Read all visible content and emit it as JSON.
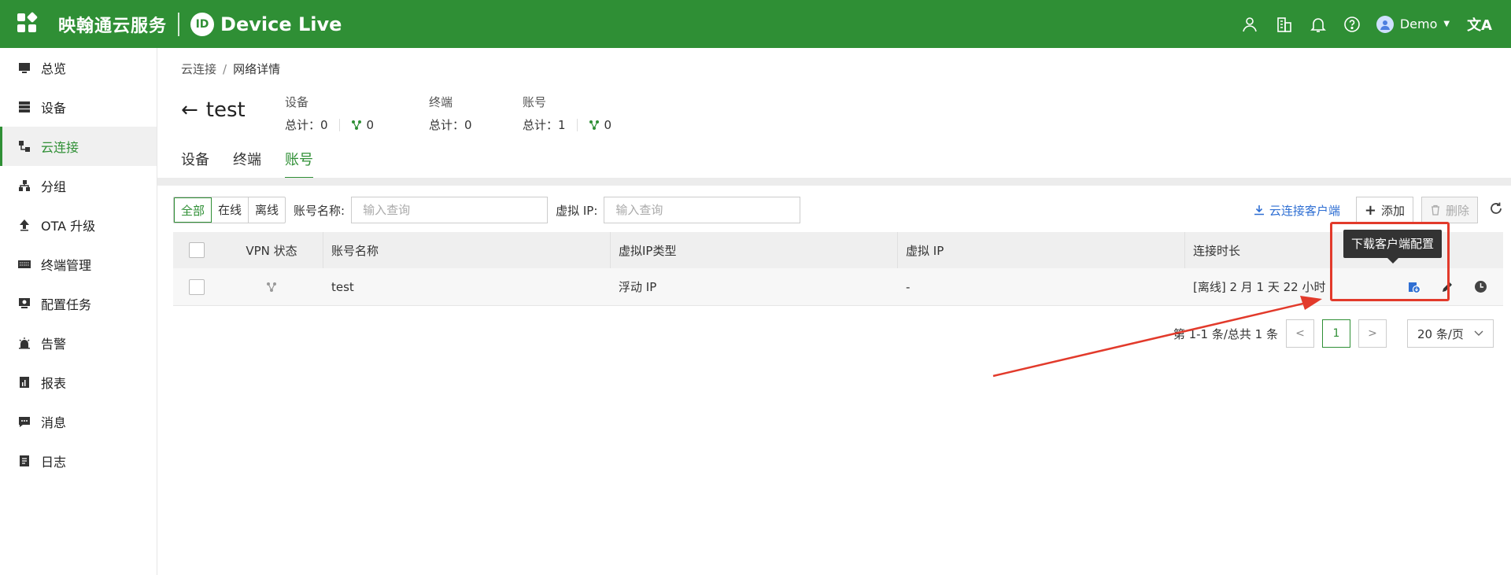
{
  "header": {
    "brand_cn": "映翰通云服务",
    "logo_text": "ID",
    "brand_en": "Device Live",
    "user": "Demo",
    "lang_icon": "文A"
  },
  "sidebar": {
    "items": [
      {
        "label": "总览",
        "icon": "monitor-icon"
      },
      {
        "label": "设备",
        "icon": "server-icon"
      },
      {
        "label": "云连接",
        "icon": "network-icon",
        "active": true
      },
      {
        "label": "分组",
        "icon": "hierarchy-icon"
      },
      {
        "label": "OTA 升级",
        "icon": "upload-icon"
      },
      {
        "label": "终端管理",
        "icon": "keyboard-icon"
      },
      {
        "label": "配置任务",
        "icon": "config-icon"
      },
      {
        "label": "告警",
        "icon": "alarm-icon"
      },
      {
        "label": "报表",
        "icon": "report-icon"
      },
      {
        "label": "消息",
        "icon": "message-icon"
      },
      {
        "label": "日志",
        "icon": "log-icon"
      }
    ]
  },
  "breadcrumb": {
    "parent": "云连接",
    "separator": "/",
    "current": "网络详情"
  },
  "page": {
    "title": "test"
  },
  "stats": {
    "device": {
      "label": "设备",
      "total": "总计：0",
      "online": "0"
    },
    "terminal": {
      "label": "终端",
      "total": "总计：0"
    },
    "account": {
      "label": "账号",
      "total": "总计：1",
      "online": "0"
    }
  },
  "tabs": [
    "设备",
    "终端",
    "账号"
  ],
  "toolbar": {
    "filters": [
      "全部",
      "在线",
      "离线"
    ],
    "account_label": "账号名称:",
    "account_placeholder": "输入查询",
    "vip_label": "虚拟 IP:",
    "vip_placeholder": "输入查询",
    "download_client": "云连接客户端",
    "add": "添加",
    "delete": "删除"
  },
  "table": {
    "headers": [
      "VPN 状态",
      "账号名称",
      "虚拟IP类型",
      "虚拟 IP",
      "连接时长"
    ],
    "rows": [
      {
        "name": "test",
        "ip_type": "浮动 IP",
        "vip": "-",
        "duration": "[离线] 2 月 1 天 22 小时"
      }
    ]
  },
  "tooltip": "下载客户端配置",
  "pagination": {
    "summary": "第 1-1 条/总共 1 条",
    "prev": "<",
    "current": "1",
    "next": ">",
    "page_size": "20 条/页"
  },
  "colors": {
    "brand": "#2f8f35",
    "link": "#2f6fd3",
    "annotation": "#e23a2b"
  }
}
